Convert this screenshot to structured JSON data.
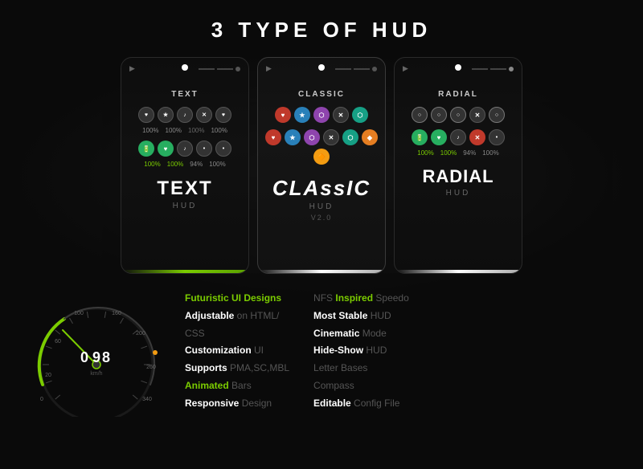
{
  "page": {
    "title": "3 TYPE OF HUD",
    "background_color": "#0a0a0a"
  },
  "hud_cards": [
    {
      "id": "text",
      "type_label": "TEXT",
      "main_title": "TEXT",
      "sub_label": "HUD",
      "bar_color": "green",
      "icons_row1": [
        "♥",
        "★",
        "🎵",
        "✕",
        "♥"
      ],
      "icons_colors": [
        "dark",
        "dark",
        "dark",
        "dark",
        "dark"
      ],
      "icons_row2": [
        "🔋",
        "❤",
        "🎵",
        "•",
        "•"
      ],
      "icons_colors2": [
        "green",
        "green",
        "dark",
        "dark",
        "dark"
      ],
      "stats": [
        "100%",
        "100%",
        "100%",
        "100%"
      ],
      "stats2": [
        "100%",
        "100%",
        "94%",
        "100%"
      ]
    },
    {
      "id": "classic",
      "type_label": "CLASSIC",
      "main_title": "CLAssIC",
      "sub_label": "HUD",
      "version": "V2.0",
      "bar_color": "white",
      "icons_row1": [
        "❤",
        "★",
        "⬡",
        "✕",
        "⬡"
      ],
      "icons_colors": [
        "red",
        "blue",
        "purple",
        "dark",
        "teal"
      ],
      "icons_row2": [
        "❤",
        "★",
        "⬡",
        "✕",
        "⬡",
        "⬡",
        "🔶"
      ],
      "icons_colors2": [
        "red",
        "blue",
        "purple",
        "dark",
        "teal",
        "orange",
        "yellow"
      ]
    },
    {
      "id": "radial",
      "type_label": "RADIAL",
      "main_title": "RADIAL",
      "sub_label": "HUD",
      "bar_color": "white",
      "icons_row1": [
        "○",
        "○",
        "○",
        "✕",
        "○"
      ],
      "icons_row2": [
        "🔋",
        "❤",
        "🎵",
        "✕",
        "•"
      ],
      "stats": [
        "100%",
        "100%",
        "94%",
        "100%"
      ]
    }
  ],
  "features_left": [
    {
      "bold": "Futuristic",
      "highlight": " UI Designs"
    },
    {
      "bold": "Adjustable",
      "normal": " on HTML/"
    },
    {
      "normal": "CSS"
    },
    {
      "bold": "Customization",
      "normal": " UI"
    },
    {
      "bold": "Supports",
      "normal": " PMA,SC,MBL"
    },
    {
      "bold": "Animated",
      "normal": " Bars"
    },
    {
      "bold": "Responsive",
      "normal": " Design"
    }
  ],
  "features_right": [
    {
      "normal": "NFS ",
      "bold": "Inspired",
      "normal2": " Speedo"
    },
    {
      "bold": "Most Stable",
      "normal": " HUD"
    },
    {
      "bold": "Cinematic",
      "normal": " Mode"
    },
    {
      "bold": "Hide-Show",
      "normal": " HUD"
    },
    {
      "normal": "Letter Bases"
    },
    {
      "normal": "Compass"
    },
    {
      "bold": "Editable",
      "normal": " Config File"
    }
  ],
  "speedometer": {
    "value": "098",
    "max": 340,
    "accent_color": "#7bcc00"
  },
  "labels": {
    "features_left": [
      "Futuristic UI Designs",
      "Adjustable on HTML/",
      "CSS",
      "Customization UI",
      "Supports PMA,SC,MBL",
      "Animated Bars",
      "Responsive Design"
    ],
    "features_right": [
      "NFS Inspired Speedo",
      "Most Stable HUD",
      "Cinematic Mode",
      "Hide-Show HUD",
      "Letter Bases",
      "Compass",
      "Editable Config File"
    ]
  }
}
